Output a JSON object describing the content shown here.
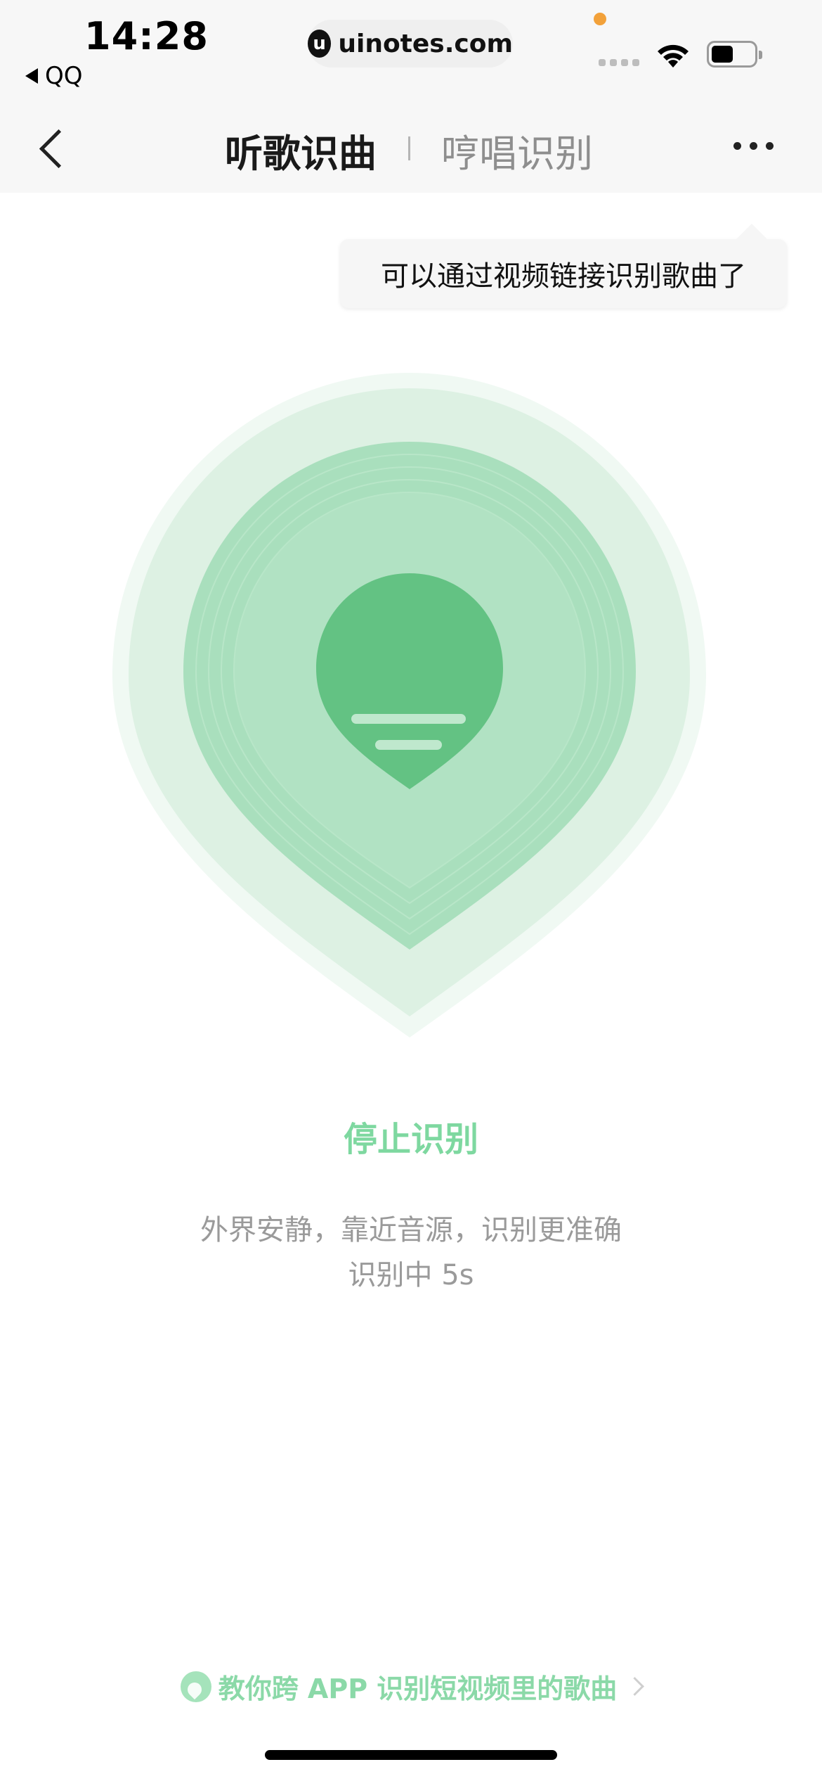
{
  "status_bar": {
    "time": "14:28",
    "back_app": "QQ",
    "url": "uinotes.com",
    "url_logo_letter": "u"
  },
  "nav": {
    "tab_active": "听歌识曲",
    "tab_inactive": "哼唱识别"
  },
  "tooltip": {
    "text": "可以通过视频链接识别歌曲了"
  },
  "main": {
    "stop_label": "停止识别",
    "hint": "外界安静，靠近音源，识别更准确",
    "status": "识别中 5s"
  },
  "promo": {
    "text": "教你跨 APP 识别短视频里的歌曲"
  },
  "colors": {
    "accent_green": "#63c283",
    "label_green": "#7ed8a0",
    "tab_inactive": "#8e8e8e"
  },
  "icons": {
    "back": "chevron-left-icon",
    "more": "more-dots-icon",
    "wifi": "wifi-icon",
    "battery": "battery-icon",
    "recognition": "music-drop-icon",
    "promo": "music-drop-small-icon",
    "promo_arrow": "chevron-right-icon"
  }
}
